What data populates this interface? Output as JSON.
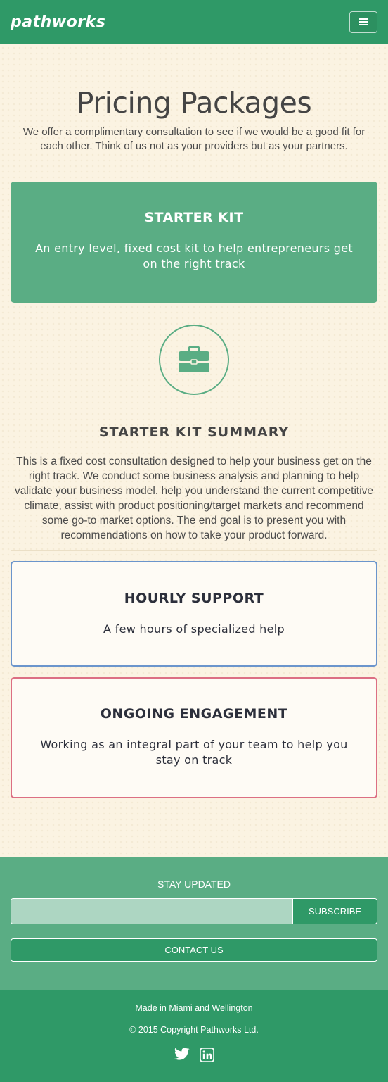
{
  "header": {
    "logo": "pathworks",
    "menu_icon": "hamburger-menu-icon"
  },
  "main": {
    "title": "Pricing Packages",
    "intro": "We offer a complimentary consultation to see if we would be a good fit for each other. Think of us not as your providers but as your partners."
  },
  "packages": [
    {
      "title": "STARTER KIT",
      "description": "An entry level, fixed cost kit to help entrepreneurs get on the right track"
    },
    {
      "title": "HOURLY SUPPORT",
      "description": "A few hours of specialized help"
    },
    {
      "title": "ONGOING ENGAGEMENT",
      "description": "Working as an integral part of your team to help you stay on track"
    }
  ],
  "summary": {
    "icon": "briefcase-icon",
    "title": "STARTER KIT SUMMARY",
    "text": "This is a fixed cost consultation designed to help your business get on the right track. We conduct some business analysis and planning to help validate your business model. help you understand the current competitive climate, assist with product positioning/target markets and recommend some go-to market options. The end goal is to present you with recommendations on how to take your product forward."
  },
  "footer": {
    "stay_updated": "STAY UPDATED",
    "email_placeholder": "",
    "subscribe": "SUBSCRIBE",
    "contact": "CONTACT US",
    "made_in": "Made in Miami and Wellington",
    "copyright": "© 2015 Copyright Pathworks Ltd.",
    "social": [
      "twitter-icon",
      "linkedin-icon"
    ]
  },
  "colors": {
    "brand_green": "#2f9967",
    "light_green": "#5aad84",
    "background": "#fbf3e2",
    "hourly_border": "#6b95cc",
    "ongoing_border": "#dc6f83"
  }
}
